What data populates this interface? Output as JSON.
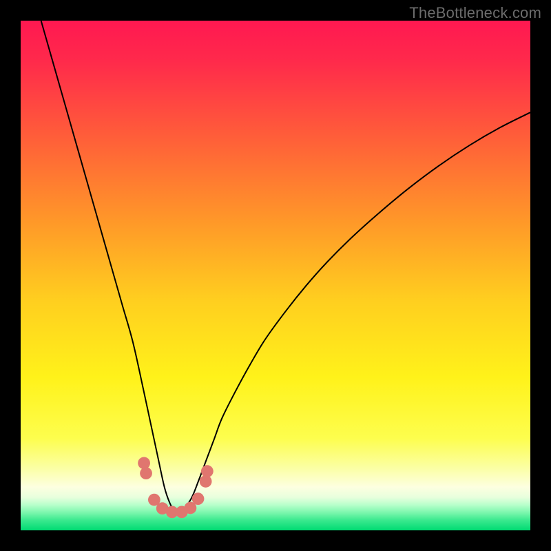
{
  "watermark": "TheBottleneck.com",
  "chart_data": {
    "type": "line",
    "title": "",
    "xlabel": "",
    "ylabel": "",
    "xlim": [
      0,
      100
    ],
    "ylim": [
      0,
      100
    ],
    "grid": false,
    "legend": false,
    "gradient_stops": [
      {
        "pos": 0.0,
        "color": "#ff1851"
      },
      {
        "pos": 0.08,
        "color": "#ff2a4b"
      },
      {
        "pos": 0.22,
        "color": "#ff5b3a"
      },
      {
        "pos": 0.4,
        "color": "#ff9a28"
      },
      {
        "pos": 0.55,
        "color": "#ffcf1f"
      },
      {
        "pos": 0.7,
        "color": "#fff21a"
      },
      {
        "pos": 0.82,
        "color": "#fdfe4e"
      },
      {
        "pos": 0.88,
        "color": "#fbffa8"
      },
      {
        "pos": 0.915,
        "color": "#fdffe0"
      },
      {
        "pos": 0.935,
        "color": "#e8ffdd"
      },
      {
        "pos": 0.95,
        "color": "#b8ffcb"
      },
      {
        "pos": 0.965,
        "color": "#7cf7ad"
      },
      {
        "pos": 0.98,
        "color": "#3be98f"
      },
      {
        "pos": 1.0,
        "color": "#00db72"
      }
    ],
    "series": [
      {
        "name": "bottleneck-curve",
        "color": "#000000",
        "x": [
          4,
          6,
          8,
          10,
          12,
          14,
          16,
          18,
          20,
          22,
          24,
          25.5,
          27,
          28.2,
          29.2,
          30,
          31,
          32.2,
          33.6,
          35,
          36.5,
          38,
          39.5,
          42,
          45,
          48,
          52,
          56,
          60,
          65,
          70,
          76,
          82,
          88,
          94,
          100
        ],
        "values": [
          100,
          93,
          86,
          79,
          72,
          65,
          58,
          51,
          44,
          37,
          28,
          21,
          14,
          8.5,
          5.5,
          4.2,
          4.0,
          4.5,
          6.5,
          10,
          14,
          18,
          22,
          27,
          32.5,
          37.5,
          43,
          48,
          52.5,
          57.5,
          62,
          67,
          71.5,
          75.5,
          79,
          82
        ]
      }
    ],
    "markers": {
      "name": "highlight-dots",
      "color": "#e0766f",
      "radius_pct": 1.2,
      "points": [
        {
          "x": 24.2,
          "y": 13.2
        },
        {
          "x": 24.6,
          "y": 11.2
        },
        {
          "x": 26.2,
          "y": 6.0
        },
        {
          "x": 27.8,
          "y": 4.3
        },
        {
          "x": 29.7,
          "y": 3.6
        },
        {
          "x": 31.6,
          "y": 3.6
        },
        {
          "x": 33.3,
          "y": 4.4
        },
        {
          "x": 34.8,
          "y": 6.2
        },
        {
          "x": 36.3,
          "y": 9.6
        },
        {
          "x": 36.6,
          "y": 11.6
        }
      ]
    }
  }
}
